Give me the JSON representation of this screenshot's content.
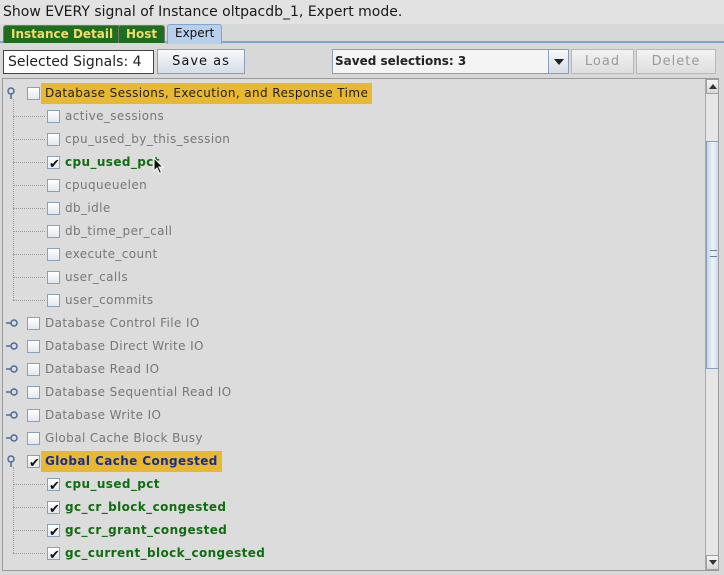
{
  "window": {
    "title": "Show EVERY signal of Instance oltpacdb_1, Expert mode."
  },
  "tabs": [
    {
      "label": "Instance Detail",
      "active": false
    },
    {
      "label": "Host",
      "active": false
    },
    {
      "label": "Expert",
      "active": true
    }
  ],
  "toolbar": {
    "selected_signals": "Selected Signals: 4",
    "save_as_label": "Save as",
    "saved_selections": "Saved selections: 3",
    "load_label": "Load",
    "delete_label": "Delete"
  },
  "tree": {
    "groups": [
      {
        "label": "Database Sessions, Execution, and Response Time",
        "expanded": true,
        "checked": false,
        "highlighted": true,
        "children": [
          {
            "label": "active_sessions",
            "checked": false
          },
          {
            "label": "cpu_used_by_this_session",
            "checked": false
          },
          {
            "label": "cpu_used_pct",
            "checked": true
          },
          {
            "label": "cpuqueuelen",
            "checked": false
          },
          {
            "label": "db_idle",
            "checked": false
          },
          {
            "label": "db_time_per_call",
            "checked": false
          },
          {
            "label": "execute_count",
            "checked": false
          },
          {
            "label": "user_calls",
            "checked": false
          },
          {
            "label": "user_commits",
            "checked": false
          }
        ]
      },
      {
        "label": "Database Control File IO",
        "expanded": false,
        "checked": false,
        "highlighted": false,
        "children": []
      },
      {
        "label": "Database Direct Write IO",
        "expanded": false,
        "checked": false,
        "highlighted": false,
        "children": []
      },
      {
        "label": "Database Read IO",
        "expanded": false,
        "checked": false,
        "highlighted": false,
        "children": []
      },
      {
        "label": "Database Sequential Read IO",
        "expanded": false,
        "checked": false,
        "highlighted": false,
        "children": []
      },
      {
        "label": "Database Write IO",
        "expanded": false,
        "checked": false,
        "highlighted": false,
        "children": []
      },
      {
        "label": "Global Cache Block Busy",
        "expanded": false,
        "checked": false,
        "highlighted": false,
        "children": []
      },
      {
        "label": "Global Cache Congested",
        "expanded": true,
        "checked": true,
        "highlighted": true,
        "children": [
          {
            "label": "cpu_used_pct",
            "checked": true
          },
          {
            "label": "gc_cr_block_congested",
            "checked": true
          },
          {
            "label": "gc_cr_grant_congested",
            "checked": true
          },
          {
            "label": "gc_current_block_congested",
            "checked": true
          }
        ]
      }
    ]
  },
  "colors": {
    "highlight": "#e7b830",
    "checked_child": "#116d11",
    "checked_group": "#142d96",
    "unchecked": "#777777",
    "tab_inactive_bg": "#1f6d1f",
    "tab_inactive_text": "#f1dd6a",
    "tab_active_bg": "#b7d0ee"
  }
}
